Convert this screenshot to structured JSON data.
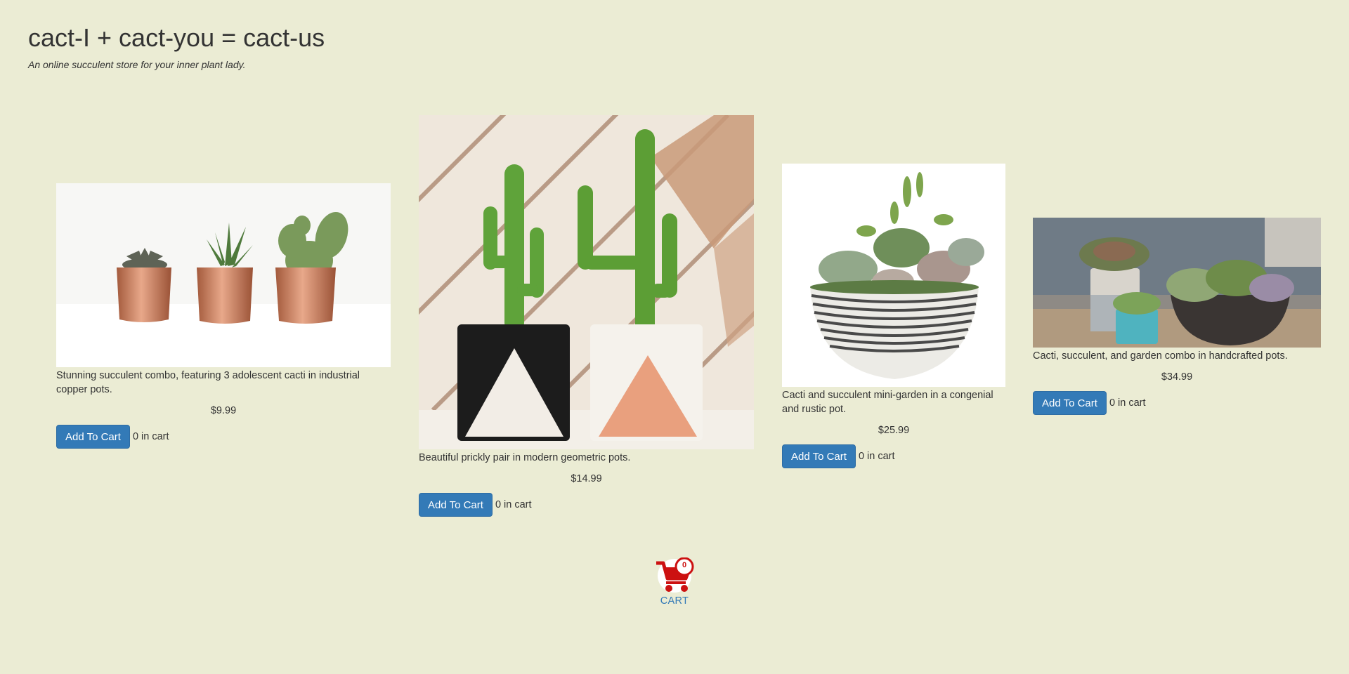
{
  "header": {
    "title": "cact-I + cact-you = cact-us",
    "tagline": "An online succulent store for your inner plant lady."
  },
  "products": [
    {
      "description": "Stunning succulent combo, featuring 3 adolescent cacti in industrial copper pots.",
      "price": "$9.99",
      "button_label": "Add To Cart",
      "in_cart_count": "0",
      "in_cart_suffix": "in cart",
      "image": "three-cacti-copper-pots-photo"
    },
    {
      "description": "Beautiful prickly pair in modern geometric pots.",
      "price": "$14.99",
      "button_label": "Add To Cart",
      "in_cart_count": "0",
      "in_cart_suffix": "in cart",
      "image": "prickly-pair-geometric-pots-photo"
    },
    {
      "description": "Cacti and succulent mini-garden in a congenial and rustic pot.",
      "price": "$25.99",
      "button_label": "Add To Cart",
      "in_cart_count": "0",
      "in_cart_suffix": "in cart",
      "image": "mini-garden-rustic-pot-photo"
    },
    {
      "description": "Cacti, succulent, and garden combo in handcrafted pots.",
      "price": "$34.99",
      "button_label": "Add To Cart",
      "in_cart_count": "0",
      "in_cart_suffix": "in cart",
      "image": "garden-combo-handcrafted-pots-photo"
    }
  ],
  "cart": {
    "label": "CART",
    "count": "0",
    "icon": "shopping-cart-icon"
  },
  "colors": {
    "background": "#ebecd4",
    "button": "#337ab7",
    "cart_icon": "#cc1111",
    "link": "#337ab7"
  }
}
